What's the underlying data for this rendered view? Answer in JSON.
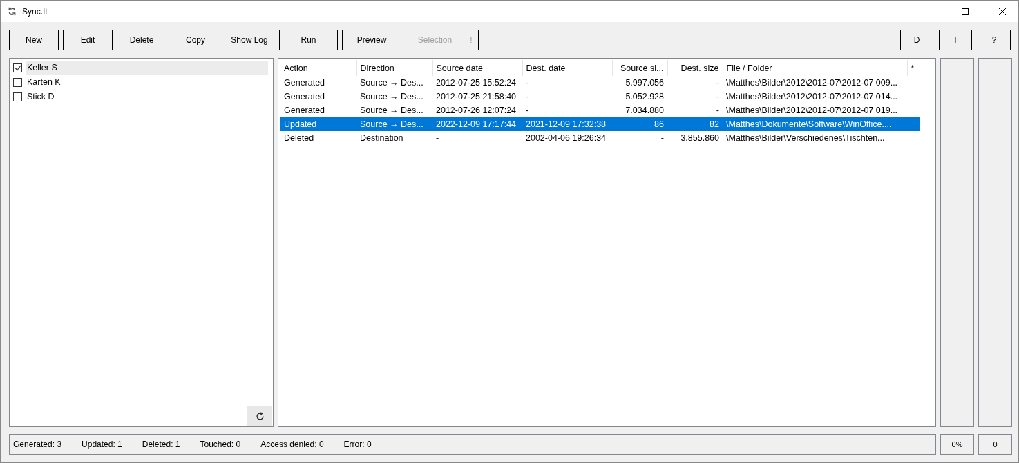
{
  "window": {
    "title": "Sync.It"
  },
  "toolbar": {
    "left": [
      {
        "label": "New",
        "disabled": false
      },
      {
        "label": "Edit",
        "disabled": false
      },
      {
        "label": "Delete",
        "disabled": false
      },
      {
        "label": "Copy",
        "disabled": false
      },
      {
        "label": "Show Log",
        "disabled": false
      }
    ],
    "middle": [
      {
        "label": "Run",
        "disabled": false
      },
      {
        "label": "Preview",
        "disabled": false
      },
      {
        "label": "Selection",
        "disabled": true
      },
      {
        "label": "!",
        "disabled": true
      }
    ],
    "right": [
      {
        "label": "D",
        "disabled": false
      },
      {
        "label": "I",
        "disabled": false
      },
      {
        "label": "?",
        "disabled": false
      }
    ]
  },
  "jobs": [
    {
      "name": "Keller S",
      "checked": true,
      "selected": true,
      "struck": false
    },
    {
      "name": "Karten K",
      "checked": false,
      "selected": false,
      "struck": false
    },
    {
      "name": "Stick D",
      "checked": false,
      "selected": false,
      "struck": true
    }
  ],
  "table": {
    "columns": [
      "Action",
      "Direction",
      "Source date",
      "Dest. date",
      "Source si...",
      "Dest. size",
      "File / Folder",
      "*"
    ],
    "rows": [
      {
        "selected": false,
        "cells": [
          "Generated",
          "Source → Des...",
          "2012-07-25 15:52:24",
          "-",
          "5.997.056",
          "-",
          "\\Matthes\\Bilder\\2012\\2012-07\\2012-07 009..."
        ]
      },
      {
        "selected": false,
        "cells": [
          "Generated",
          "Source → Des...",
          "2012-07-25 21:58:40",
          "-",
          "5.052.928",
          "-",
          "\\Matthes\\Bilder\\2012\\2012-07\\2012-07 014..."
        ]
      },
      {
        "selected": false,
        "cells": [
          "Generated",
          "Source → Des...",
          "2012-07-26 12:07:24",
          "-",
          "7.034.880",
          "-",
          "\\Matthes\\Bilder\\2012\\2012-07\\2012-07 019..."
        ]
      },
      {
        "selected": true,
        "cells": [
          "Updated",
          "Source → Des...",
          "2022-12-09 17:17:44",
          "2021-12-09 17:32:38",
          "86",
          "82",
          "\\Matthes\\Dokumente\\Software\\WinOffice...."
        ]
      },
      {
        "selected": false,
        "cells": [
          "Deleted",
          "Destination",
          "-",
          "2002-04-06 19:26:34",
          "-",
          "3.855.860",
          "\\Matthes\\Bilder\\Verschiedenes\\Tischten..."
        ]
      }
    ]
  },
  "status_bar": [
    "Generated: 3",
    "Updated: 1",
    "Deleted: 1",
    "Touched: 0",
    "Access denied: 0",
    "Error: 0"
  ],
  "progress": "0%",
  "counter": "0"
}
